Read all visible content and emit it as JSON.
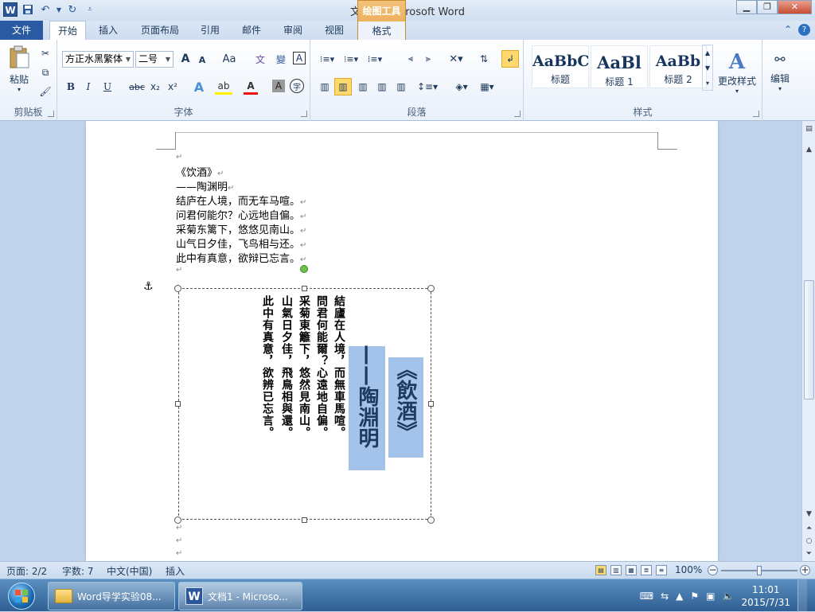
{
  "window": {
    "title": "文档1 - Microsoft Word",
    "tools_tab": "绘图工具",
    "tools_subtab": "格式"
  },
  "quick_access": {
    "logo": "W"
  },
  "tabs": [
    "文件",
    "开始",
    "插入",
    "页面布局",
    "引用",
    "邮件",
    "审阅",
    "视图"
  ],
  "ribbon": {
    "clipboard": {
      "label": "剪贴板",
      "paste": "粘贴"
    },
    "font": {
      "label": "字体",
      "font_name": "方正水黑繁体",
      "font_size": "二号",
      "grow": "A",
      "shrink": "A",
      "change_case": "Aa",
      "bold": "B",
      "italic": "I",
      "underline": "U",
      "strike": "abc",
      "subscript": "x₂",
      "superscript": "x²",
      "char_border": "A",
      "char_shading": "A",
      "enclose": "字"
    },
    "paragraph": {
      "label": "段落"
    },
    "styles": {
      "label": "样式",
      "items": [
        {
          "sample": "AaBbC",
          "name": "标题"
        },
        {
          "sample": "AaBl",
          "name": "标题 1"
        },
        {
          "sample": "AaBb",
          "name": "标题 2"
        }
      ],
      "change_styles": "更改样式"
    },
    "editing": {
      "label": "编辑"
    }
  },
  "document": {
    "lines": [
      "《饮酒》",
      "——陶渊明",
      "结庐在人境，而无车马喧。",
      "问君何能尔？心远地自偏。",
      "采菊东篱下，悠悠见南山。",
      "山气日夕佳，飞鸟相与还。",
      "此中有真意，欲辩已忘言。"
    ],
    "paragraph_mark": "↵",
    "textbox": {
      "title": "《飲酒》",
      "author": "——陶淵明",
      "columns": [
        "結廬在人境，而無車馬喧。",
        "問君何能爾？心遠地自偏。",
        "采菊東籬下，悠然見南山。",
        "山氣日夕佳，飛鳥相與還。",
        "此中有真意，欲辨已忘言。"
      ]
    },
    "highlight_color": "#a4c3ea"
  },
  "status": {
    "page": "页面: 2/2",
    "words": "字数: 7",
    "language": "中文(中国)",
    "mode": "插入",
    "zoom": "100%",
    "zoom_level": 0.5
  },
  "taskbar": {
    "items": [
      {
        "label": "Word导学实验08...",
        "icon": "folder-icon"
      },
      {
        "label": "文档1 - Microso...",
        "icon": "word-icon"
      }
    ],
    "time": "11:01",
    "date": "2015/7/31"
  }
}
